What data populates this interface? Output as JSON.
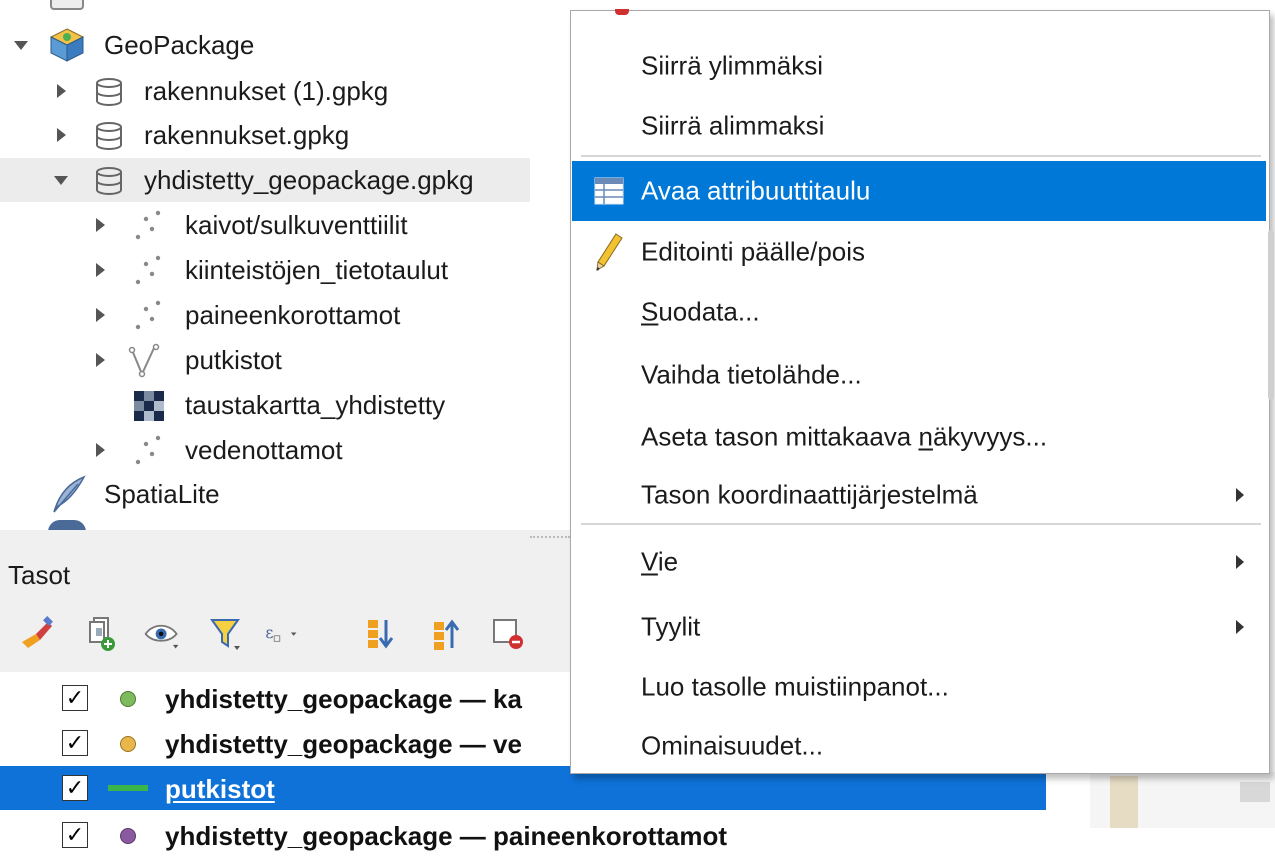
{
  "browser": {
    "items": [
      {
        "label": "GeoPackage",
        "icon": "geopackage-icon",
        "expanded": true
      },
      {
        "label": "rakennukset (1).gpkg",
        "icon": "database-icon"
      },
      {
        "label": "rakennukset.gpkg",
        "icon": "database-icon"
      },
      {
        "label": "yhdistetty_geopackage.gpkg",
        "icon": "database-icon",
        "expanded": true,
        "selected": true
      },
      {
        "label": "kaivot/sulkuventtiilit",
        "icon": "point-layer-icon"
      },
      {
        "label": "kiinteistöjen_tietotaulut",
        "icon": "point-layer-icon"
      },
      {
        "label": "paineenkorottamot",
        "icon": "point-layer-icon"
      },
      {
        "label": "putkistot",
        "icon": "line-layer-icon"
      },
      {
        "label": "taustakartta_yhdistetty",
        "icon": "raster-layer-icon"
      },
      {
        "label": "vedenottamot",
        "icon": "point-layer-icon"
      },
      {
        "label": "SpatiaLite",
        "icon": "spatialite-icon"
      }
    ]
  },
  "layers_panel": {
    "title": "Tasot",
    "toolbar": [
      "style-brush-icon",
      "add-group-icon",
      "visibility-eye-icon",
      "filter-legend-icon",
      "expression-filter-icon",
      "expand-all-icon",
      "collapse-all-icon",
      "remove-layer-icon"
    ],
    "layers": [
      {
        "name": "yhdistetty_geopackage — ka",
        "checked": true,
        "symbol_color": "#7fba5c",
        "symbol": "point"
      },
      {
        "name": "yhdistetty_geopackage — ve",
        "checked": true,
        "symbol_color": "#e8b74a",
        "symbol": "point"
      },
      {
        "name": "putkistot",
        "checked": true,
        "symbol_color": "#3bb54a",
        "symbol": "line",
        "selected": true
      },
      {
        "name": "yhdistetty_geopackage — paineenkorottamot",
        "checked": true,
        "symbol_color": "#8a5aa0",
        "symbol": "point"
      }
    ]
  },
  "context_menu": {
    "items": [
      {
        "label": "Siirrä ylimmäksi"
      },
      {
        "label": "Siirrä alimmaksi"
      },
      {
        "label": "Avaa attribuuttitaulu",
        "icon": "attribute-table-icon",
        "highlighted": true
      },
      {
        "label": "Editointi päälle/pois",
        "icon": "pencil-icon"
      },
      {
        "label": "Suodata...",
        "mnemonic_pre": "",
        "mnemonic": "S",
        "mnemonic_post": "uodata..."
      },
      {
        "label": "Vaihda tietolähde..."
      },
      {
        "label": "Aseta tason mittakaava näkyvyys...",
        "mnemonic_pre": "Aseta tason mittakaava ",
        "mnemonic": "n",
        "mnemonic_post": "äkyvyys..."
      },
      {
        "label": "Tason koordinaattijärjestelmä",
        "submenu": true
      },
      {
        "label": "Vie",
        "mnemonic_pre": "",
        "mnemonic": "V",
        "mnemonic_post": "ie",
        "submenu": true
      },
      {
        "label": "Tyylit",
        "submenu": true
      },
      {
        "label": "Luo tasolle muistiinpanot..."
      },
      {
        "label": "Ominaisuudet..."
      }
    ]
  },
  "colors": {
    "menu_highlight": "#0078d7",
    "layer_selection": "#0e72d8"
  }
}
